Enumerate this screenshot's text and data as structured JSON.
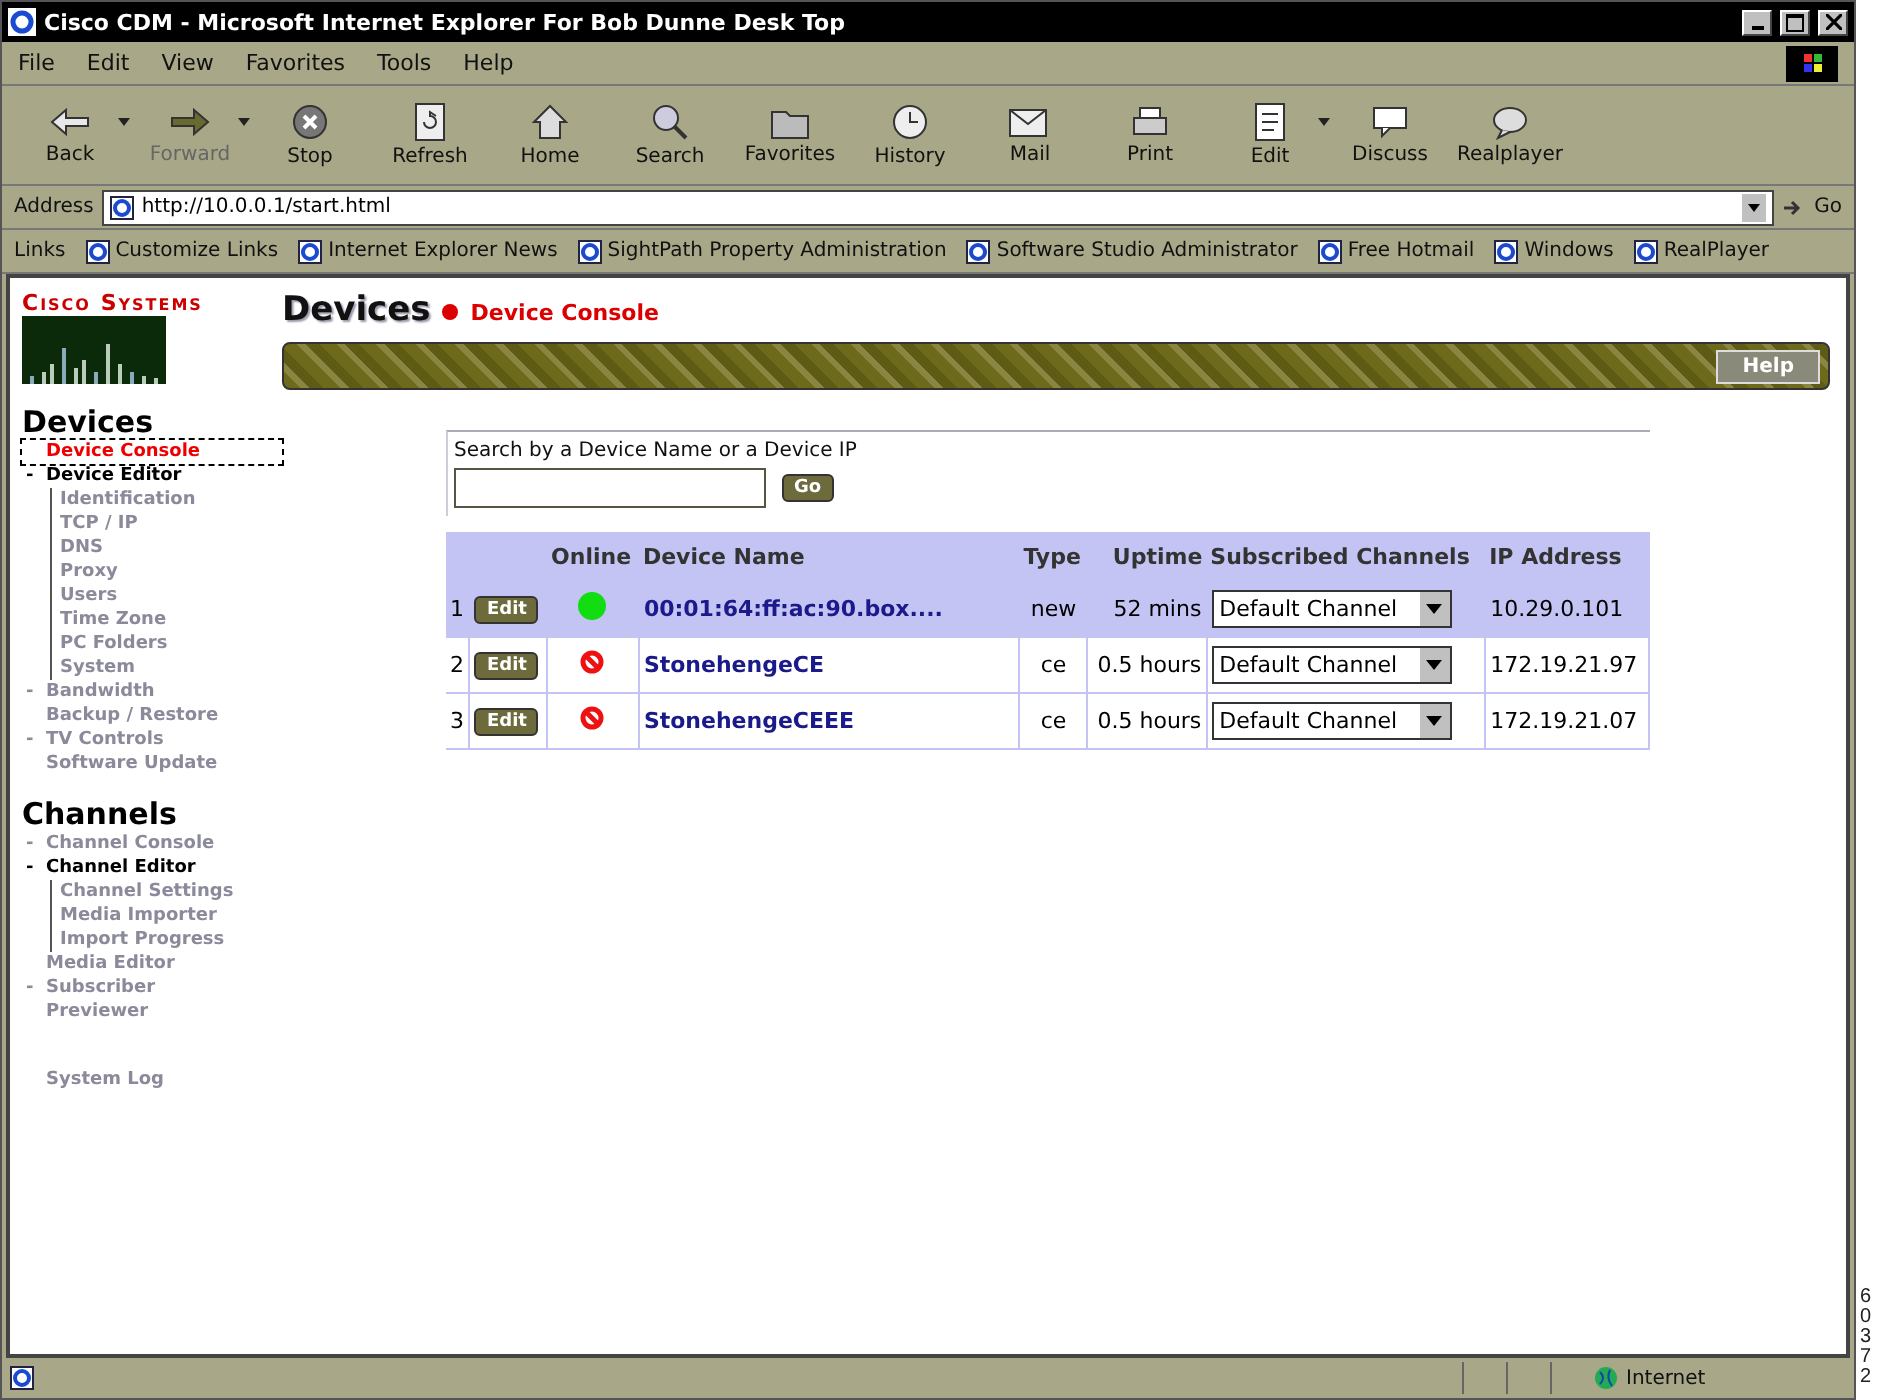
{
  "window": {
    "title": "Cisco CDM - Microsoft Internet Explorer For Bob Dunne Desk Top"
  },
  "menu": [
    "File",
    "Edit",
    "View",
    "Favorites",
    "Tools",
    "Help"
  ],
  "toolbar": [
    {
      "kind": "back",
      "label": "Back",
      "dropdown": true,
      "disabled": false
    },
    {
      "kind": "forward",
      "label": "Forward",
      "dropdown": true,
      "disabled": true
    },
    {
      "kind": "stop",
      "label": "Stop",
      "dropdown": false,
      "disabled": false
    },
    {
      "kind": "refresh",
      "label": "Refresh",
      "dropdown": false,
      "disabled": false
    },
    {
      "kind": "home",
      "label": "Home",
      "dropdown": false,
      "disabled": false
    },
    {
      "kind": "search",
      "label": "Search",
      "dropdown": false,
      "disabled": false
    },
    {
      "kind": "favorites",
      "label": "Favorites",
      "dropdown": false,
      "disabled": false
    },
    {
      "kind": "history",
      "label": "History",
      "dropdown": false,
      "disabled": false
    },
    {
      "kind": "mail",
      "label": "Mail",
      "dropdown": false,
      "disabled": false
    },
    {
      "kind": "print",
      "label": "Print",
      "dropdown": false,
      "disabled": false
    },
    {
      "kind": "edit",
      "label": "Edit",
      "dropdown": true,
      "disabled": false
    },
    {
      "kind": "discuss",
      "label": "Discuss",
      "dropdown": false,
      "disabled": false
    },
    {
      "kind": "realplayer",
      "label": "Realplayer",
      "dropdown": false,
      "disabled": false
    }
  ],
  "address": {
    "label": "Address",
    "value": "http://10.0.0.1/start.html",
    "go": "Go"
  },
  "links": {
    "label": "Links",
    "items": [
      "Customize Links",
      "Internet Explorer News",
      "SightPath Property Administration",
      "Software Studio Administrator",
      "Free Hotmail",
      "Windows",
      "RealPlayer"
    ]
  },
  "logo": {
    "text": "Cisco Systems"
  },
  "sidebar": [
    {
      "title": "Devices",
      "items": [
        {
          "label": "Device Console",
          "marker": "",
          "selected": true
        },
        {
          "label": "Device Editor",
          "marker": "-",
          "selected": false,
          "expanded": true,
          "children": [
            {
              "label": "Identification",
              "selected": false
            },
            {
              "label": "TCP / IP",
              "selected": false
            },
            {
              "label": "DNS",
              "selected": false
            },
            {
              "label": "Proxy",
              "selected": false
            },
            {
              "label": "Users",
              "selected": false
            },
            {
              "label": "Time Zone",
              "selected": false
            },
            {
              "label": "PC Folders",
              "selected": false
            },
            {
              "label": "System",
              "selected": false
            }
          ]
        },
        {
          "label": "Bandwidth",
          "marker": "-",
          "selected": false
        },
        {
          "label": "Backup / Restore",
          "marker": "",
          "selected": false
        },
        {
          "label": "TV Controls",
          "marker": "-",
          "selected": false
        },
        {
          "label": "Software Update",
          "marker": "",
          "selected": false
        }
      ]
    },
    {
      "title": "Channels",
      "items": [
        {
          "label": "Channel Console",
          "marker": "-",
          "selected": false
        },
        {
          "label": "Channel Editor",
          "marker": "-",
          "selected": false,
          "expanded": true,
          "children": [
            {
              "label": "Channel Settings",
              "selected": false
            },
            {
              "label": "Media Importer",
              "selected": false
            },
            {
              "label": "Import Progress",
              "selected": false
            }
          ]
        },
        {
          "label": "Media Editor",
          "marker": "",
          "selected": false
        },
        {
          "label": "Subscriber",
          "marker": "-",
          "selected": false
        },
        {
          "label": "Previewer",
          "marker": "",
          "selected": false
        }
      ]
    },
    {
      "items": [
        {
          "label": "System Log",
          "marker": "",
          "selected": false
        }
      ]
    }
  ],
  "page": {
    "title": "Devices",
    "subtitle": "Device Console",
    "help": "Help"
  },
  "search": {
    "label": "Search by a Device Name or a Device IP",
    "button": "Go"
  },
  "table": {
    "columns": [
      "",
      "",
      "Online",
      "Device Name",
      "Type",
      "Uptime",
      "Subscribed Channels",
      "IP Address"
    ],
    "rows": [
      {
        "index": "1",
        "edit": "Edit",
        "online": true,
        "name": "00:01:64:ff:ac:90.box....",
        "type": "new",
        "uptime": "52 mins",
        "channel": "Default Channel",
        "ip": "10.29.0.101",
        "selected": true
      },
      {
        "index": "2",
        "edit": "Edit",
        "online": false,
        "name": "StonehengeCE",
        "type": "ce",
        "uptime": "0.5 hours",
        "channel": "Default Channel",
        "ip": "172.19.21.97",
        "selected": false
      },
      {
        "index": "3",
        "edit": "Edit",
        "online": false,
        "name": "StonehengeCEEE",
        "type": "ce",
        "uptime": "0.5 hours",
        "channel": "Default Channel",
        "ip": "172.19.21.07",
        "selected": false
      }
    ]
  },
  "status_bar": {
    "zone": "Internet"
  },
  "figure_number": "60372"
}
